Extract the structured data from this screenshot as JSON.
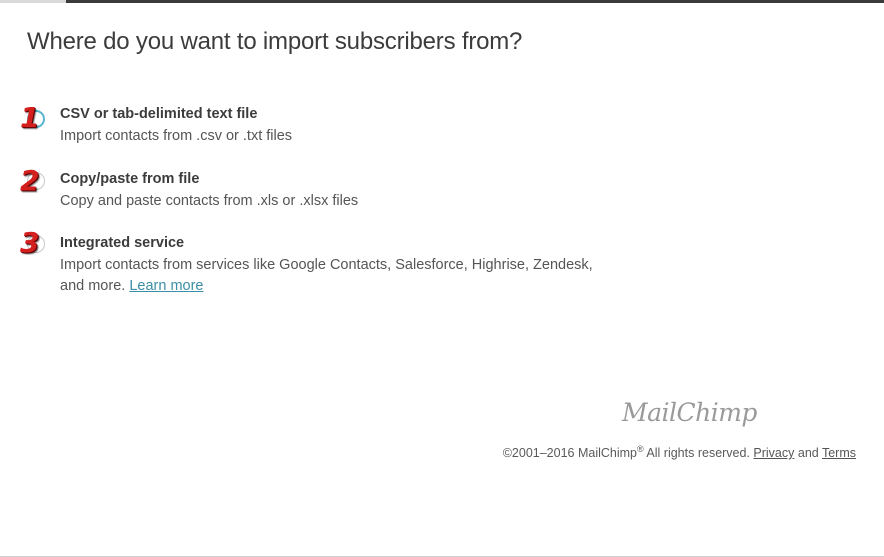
{
  "heading": "Where do you want to import subscribers from?",
  "options": [
    {
      "number": "1",
      "title": "CSV or tab-delimited text file",
      "description": "Import contacts from .csv or .txt files"
    },
    {
      "number": "2",
      "title": "Copy/paste from file",
      "description": "Copy and paste contacts from .xls or .xlsx files"
    },
    {
      "number": "3",
      "title": "Integrated service",
      "description": "Import contacts from services like Google Contacts, Salesforce, Highrise, Zendesk, and more.",
      "link": "Learn more"
    }
  ],
  "logo": "MailChimp",
  "footer": {
    "copyright": "©2001–2016 MailChimp",
    "registered": "®",
    "rights": " All rights reserved. ",
    "privacy": "Privacy",
    "and": " and ",
    "terms": "Terms"
  },
  "colors": {
    "annotation_red": "#d41f1f",
    "link": "#3b8ea5",
    "focus": "#57b5cf"
  }
}
